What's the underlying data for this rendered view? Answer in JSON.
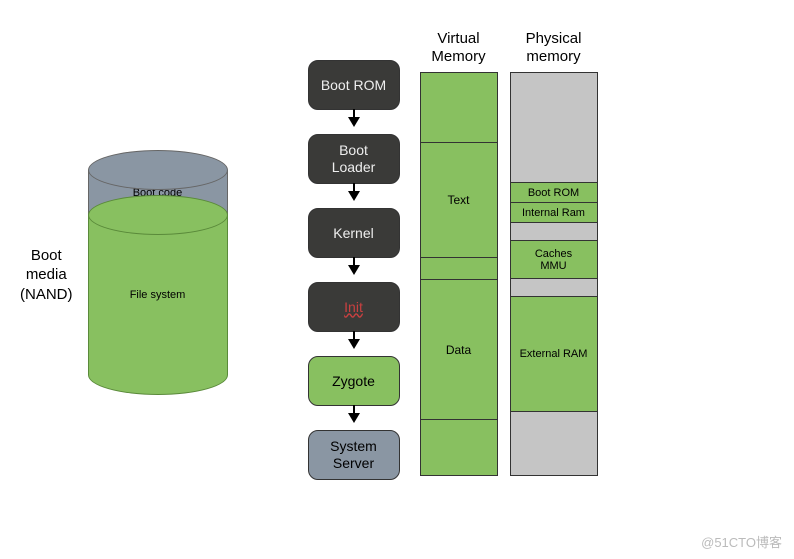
{
  "boot_media_label_l1": "Boot",
  "boot_media_label_l2": "media",
  "boot_media_label_l3": "(NAND)",
  "cylinder": {
    "bootcode": "Boot code",
    "filesystem": "File system"
  },
  "flow": {
    "bootrom": "Boot ROM",
    "bootloader_l1": "Boot",
    "bootloader_l2": "Loader",
    "kernel": "Kernel",
    "init": "Init",
    "zygote": "Zygote",
    "system_l1": "System",
    "system_l2": "Server"
  },
  "vmem": {
    "title_l1": "Virtual",
    "title_l2": "Memory",
    "text": "Text",
    "data": "Data"
  },
  "pmem": {
    "title_l1": "Physical",
    "title_l2": "memory",
    "bootrom": "Boot ROM",
    "internal_ram": "Internal Ram",
    "caches": "Caches",
    "mmu": "MMU",
    "external_ram": "External RAM"
  },
  "watermark": "@51CTO博客",
  "chart_data": {
    "type": "diagram",
    "boot_media": {
      "label": "Boot media (NAND)",
      "layers": [
        "Boot code",
        "File system"
      ]
    },
    "boot_flow": [
      "Boot ROM",
      "Boot Loader",
      "Kernel",
      "Init",
      "Zygote",
      "System Server"
    ],
    "virtual_memory": {
      "segments": [
        "(top)",
        "Text",
        "(gap)",
        "Data",
        "(bottom)"
      ]
    },
    "physical_memory": {
      "segments": [
        "(grey)",
        "Boot ROM",
        "Internal Ram",
        "(grey)",
        "Caches MMU",
        "(grey)",
        "External RAM",
        "(grey)"
      ]
    }
  }
}
